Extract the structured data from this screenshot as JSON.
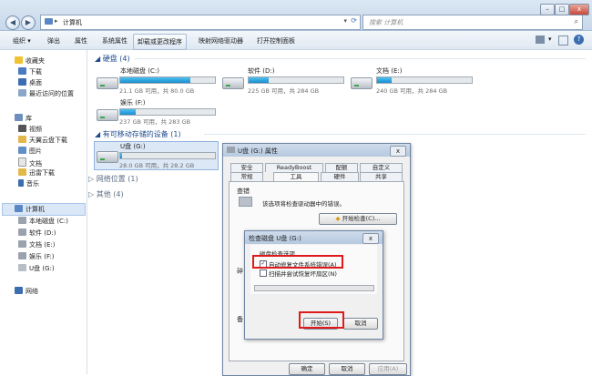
{
  "window": {
    "breadcrumb": "计算机",
    "search_placeholder": "搜索 计算机",
    "min_label": "–",
    "max_label": "□",
    "close_label": "x"
  },
  "toolbar": {
    "organize": "组织 ▾",
    "eject": "弹出",
    "properties": "属性",
    "system_properties": "系统属性",
    "uninstall": "卸载或更改程序",
    "map_drive": "映射网络驱动器",
    "control_panel": "打开控制面板"
  },
  "sidebar": {
    "favorites": "收藏夹",
    "downloads": "下载",
    "desktop": "桌面",
    "recent": "最近访问的位置",
    "libraries": "库",
    "videos": "视频",
    "tianyi": "天翼云盘下载",
    "pictures": "图片",
    "documents": "文档",
    "thunder": "迅雷下载",
    "music": "音乐",
    "computer": "计算机",
    "local_c": "本地磁盘 (C:)",
    "soft_d": "软件 (D:)",
    "doc_e": "文档 (E:)",
    "ent_f": "娱乐 (F:)",
    "usb_g": "U盘 (G:)",
    "network": "网络"
  },
  "main": {
    "hdd_group": "硬盘 (4)",
    "removable_group": "有可移动存储的设备 (1)",
    "netloc_group": "网络位置 (1)",
    "other_group": "其他 (4)",
    "drives": [
      {
        "name": "本地磁盘 (C:)",
        "size": "21.1 GB 可用，共 80.0 GB",
        "used_fraction": 0.74
      },
      {
        "name": "软件 (D:)",
        "size": "225 GB 可用，共 284 GB",
        "used_fraction": 0.21
      },
      {
        "name": "文档 (E:)",
        "size": "240 GB 可用，共 284 GB",
        "used_fraction": 0.15
      },
      {
        "name": "娱乐 (F:)",
        "size": "237 GB 可用，共 283 GB",
        "used_fraction": 0.16
      },
      {
        "name": "U盘 (G:)",
        "size": "28.0 GB 可用，共 28.2 GB",
        "used_fraction": 0.01
      }
    ]
  },
  "props_dialog": {
    "title": "U盘 (G:) 属性",
    "tabs_row1": [
      "安全",
      "ReadyBoost",
      "配额",
      "自定义"
    ],
    "tabs_row2": [
      "常规",
      "工具",
      "硬件",
      "共享"
    ],
    "section_check": "查错",
    "check_desc": "该选项将检查驱动器中的错误。",
    "check_now": "开始检查(C)...",
    "ok": "确定",
    "cancel": "取消",
    "apply": "应用(A)"
  },
  "check_dialog": {
    "title": "检查磁盘 U盘 (G:)",
    "options_label": "磁盘检查选项",
    "auto_fix": "自动修复文件系统错误(A)",
    "auto_fix_checked": true,
    "scan_recover": "扫描并尝试恢复坏扇区(N)",
    "scan_recover_checked": false,
    "start": "开始(S)",
    "cancel": "取消",
    "close_label": "x"
  },
  "colors": {
    "accent_blue": "#1d4a8f",
    "highlight_red": "#e0191a",
    "bar_fill": "#1a8cd0"
  }
}
